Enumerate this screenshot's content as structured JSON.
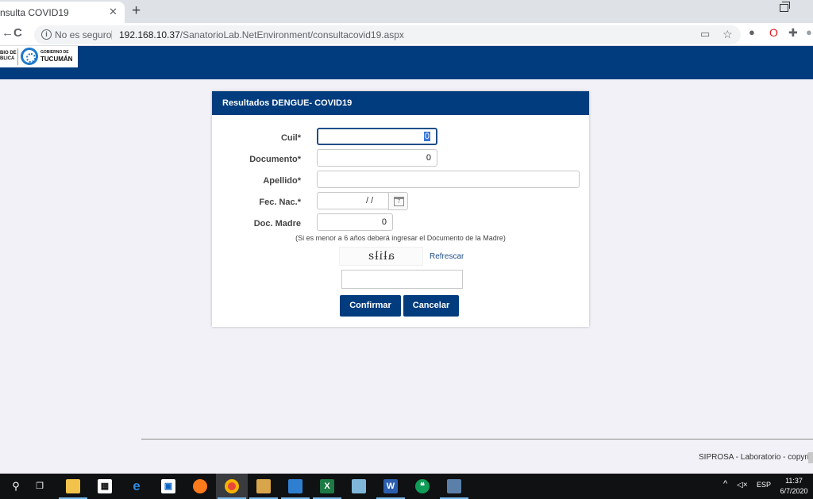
{
  "browser": {
    "tab_title": "nsulta COVID19",
    "tab_close": "✕",
    "new_tab": "+",
    "back": "←",
    "reload": "C",
    "security": "No es seguro",
    "url_host": "192.168.10.37",
    "url_path": "/SanatorioLab.NetEnvironment/consultacovid19.aspx"
  },
  "header": {
    "logo_left": "BIO DE\nBLICA",
    "logo_line1": "GOBIERNO DE",
    "logo_line2": "TUCUMÁN"
  },
  "form": {
    "title": "Resultados DENGUE- COVID19",
    "cuil_label": "Cuil*",
    "cuil_value": "0",
    "documento_label": "Documento*",
    "documento_value": "0",
    "apellido_label": "Apellido*",
    "apellido_value": "",
    "fecnac_label": "Fec. Nac.*",
    "fecnac_value": "/ /",
    "docmadre_label": "Doc. Madre",
    "docmadre_value": "0",
    "hint": "(Si es menor a 6 años deberá ingresar el Documento de la Madre)",
    "captcha_text": "aƚiƚƨ",
    "refresh": "Refrescar",
    "captcha_input": "",
    "confirm": "Confirmar",
    "cancel": "Cancelar"
  },
  "footer": {
    "text": "SIPROSA - Laboratorio - copyrigh"
  },
  "taskbar": {
    "lang": "ESP",
    "time": "11:37",
    "date": "6/7/2020"
  }
}
